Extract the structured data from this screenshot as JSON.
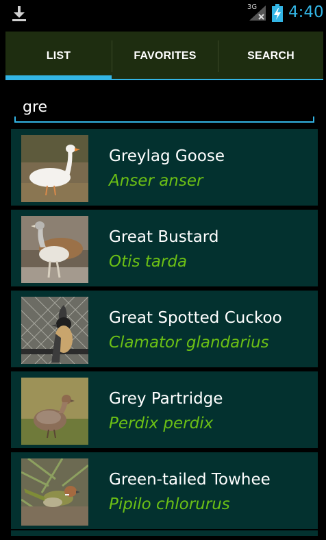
{
  "status_bar": {
    "time": "4:40",
    "network_label": "3G",
    "download_icon": "download-icon",
    "signal_icon": "signal-icon",
    "battery_icon": "battery-charging-icon",
    "clock_color": "#33b5e5"
  },
  "tabs": [
    {
      "label": "LIST",
      "active": true
    },
    {
      "label": "FAVORITES",
      "active": false
    },
    {
      "label": "SEARCH",
      "active": false
    }
  ],
  "search": {
    "value": "gre",
    "accent_color": "#33b5e5"
  },
  "results": [
    {
      "common_name": "Greylag Goose",
      "scientific_name": "Anser anser"
    },
    {
      "common_name": "Great Bustard",
      "scientific_name": "Otis tarda"
    },
    {
      "common_name": "Great Spotted Cuckoo",
      "scientific_name": "Clamator glandarius"
    },
    {
      "common_name": "Grey Partridge",
      "scientific_name": "Perdix perdix"
    },
    {
      "common_name": "Green-tailed Towhee",
      "scientific_name": "Pipilo chlorurus"
    }
  ],
  "colors": {
    "tab_bar": "#1e2d10",
    "row_background": "#03312f",
    "scientific_name": "#6cc015"
  }
}
